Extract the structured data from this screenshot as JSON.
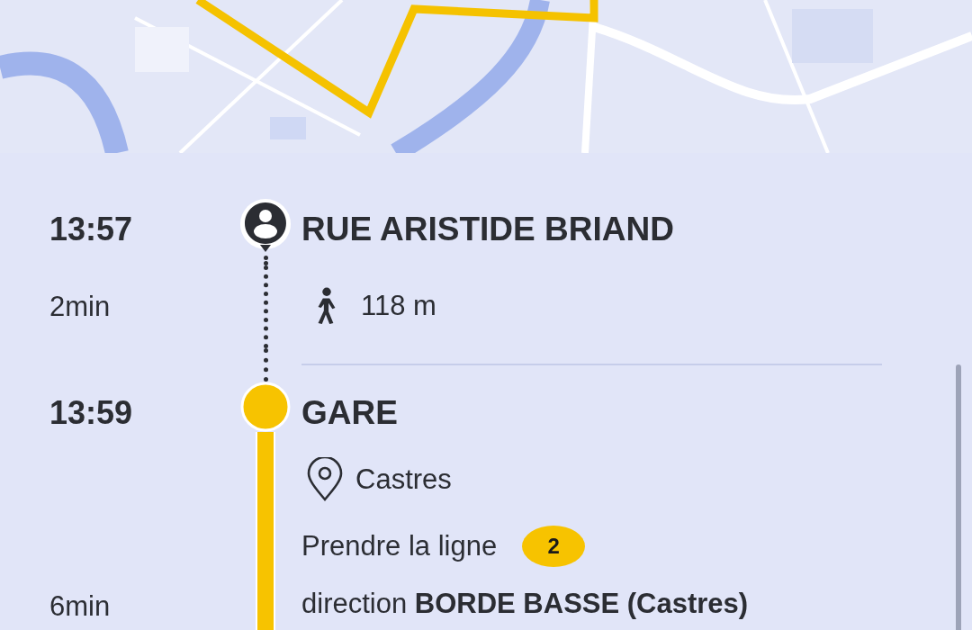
{
  "stops": [
    {
      "kind": "walk",
      "time": "13:57",
      "name": "RUE ARISTIDE BRIAND",
      "duration": "2min",
      "distance": "118 m"
    },
    {
      "kind": "bus",
      "time": "13:59",
      "name": "GARE",
      "city": "Castres",
      "take_line": "Prendre la ligne",
      "line": "2",
      "duration": "6min",
      "direction": "direction **BORDE BASSE (Castres)**"
    }
  ]
}
